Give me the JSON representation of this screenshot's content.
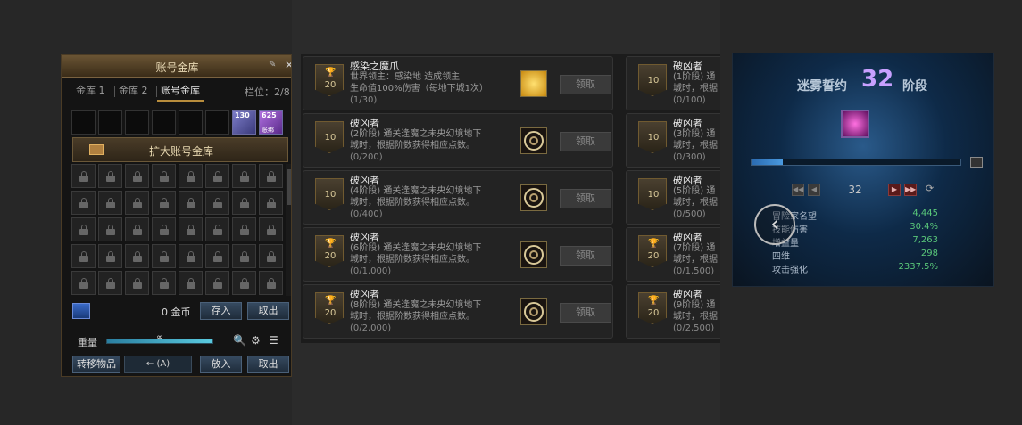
{
  "storage": {
    "title": "账号金库",
    "tabs": [
      "金库 1",
      "金库 2",
      "账号金库"
    ],
    "active_tab": 2,
    "slots_label": "栏位：2/8",
    "items": [
      {
        "count": "130",
        "sub": "",
        "icon": "blue-gem-icon"
      },
      {
        "count": "625",
        "sub": "账绑",
        "icon": "purple-crystal-icon"
      }
    ],
    "expand_label": "扩大账号金库",
    "gold_amount": "0 金币",
    "deposit_label": "存入",
    "withdraw_label": "取出",
    "weight_label": "重量",
    "weight_value": "∞",
    "weight_fill": 1.0,
    "transfer_label": "转移物品",
    "transfer_tool_text": "← (A)",
    "put_in_label": "放入",
    "take_out_label": "取出"
  },
  "achievements": {
    "claim_label": "领取",
    "left": [
      {
        "title": "感染之魔爪",
        "desc1": "世界领主：感染地        造成领主",
        "desc2": "生命值100%伤害（每地下城1次）",
        "progress": "(1/30)",
        "points": "20",
        "trophy": true,
        "reward": "gold-star-icon"
      },
      {
        "title": "破凶者",
        "desc1": "(2阶段) 通关逢魔之未央幻境地下",
        "desc2": "城时，根据阶数获得相应点数。",
        "progress": "(0/200)",
        "points": "10",
        "trophy": false,
        "reward": "ring-emblem-icon"
      },
      {
        "title": "破凶者",
        "desc1": "(4阶段) 通关逢魔之未央幻境地下",
        "desc2": "城时，根据阶数获得相应点数。",
        "progress": "(0/400)",
        "points": "10",
        "trophy": false,
        "reward": "ring-emblem-icon"
      },
      {
        "title": "破凶者",
        "desc1": "(6阶段) 通关逢魔之未央幻境地下",
        "desc2": "城时，根据阶数获得相应点数。",
        "progress": "(0/1,000)",
        "points": "20",
        "trophy": true,
        "reward": "ring-emblem-icon"
      },
      {
        "title": "破凶者",
        "desc1": "(8阶段) 通关逢魔之未央幻境地下",
        "desc2": "城时，根据阶数获得相应点数。",
        "progress": "(0/2,000)",
        "points": "20",
        "trophy": true,
        "reward": "ring-emblem-icon"
      }
    ],
    "right": [
      {
        "title": "破凶者",
        "desc1": "(1阶段) 通",
        "desc2": "城时，根据",
        "progress": "(0/100)",
        "points": "10",
        "trophy": false
      },
      {
        "title": "破凶者",
        "desc1": "(3阶段) 通",
        "desc2": "城时，根据",
        "progress": "(0/300)",
        "points": "10",
        "trophy": false
      },
      {
        "title": "破凶者",
        "desc1": "(5阶段) 通",
        "desc2": "城时，根据",
        "progress": "(0/500)",
        "points": "10",
        "trophy": false
      },
      {
        "title": "破凶者",
        "desc1": "(7阶段) 通",
        "desc2": "城时，根据",
        "progress": "(0/1,500)",
        "points": "20",
        "trophy": true
      },
      {
        "title": "破凶者",
        "desc1": "(9阶段) 通",
        "desc2": "城时，根据",
        "progress": "(0/2,500)",
        "points": "20",
        "trophy": true
      }
    ]
  },
  "contract": {
    "title": "迷雾誓约",
    "number": "32",
    "stage_label": "阶段",
    "progress_fill": 0.15,
    "page_number": "32",
    "stats": [
      {
        "label": "冒险家名望",
        "value": "4,445"
      },
      {
        "label": "技能伤害",
        "value": "30.4%"
      },
      {
        "label": "增益量",
        "value": "7,263"
      },
      {
        "label": "四维",
        "value": "298"
      },
      {
        "label": "攻击强化",
        "value": "2337.5%"
      }
    ]
  },
  "colors": {
    "background": "#272727",
    "gold_text": "#eadbb6",
    "stat_value": "#5ac87a",
    "contract_number": "#c8a0ff"
  }
}
